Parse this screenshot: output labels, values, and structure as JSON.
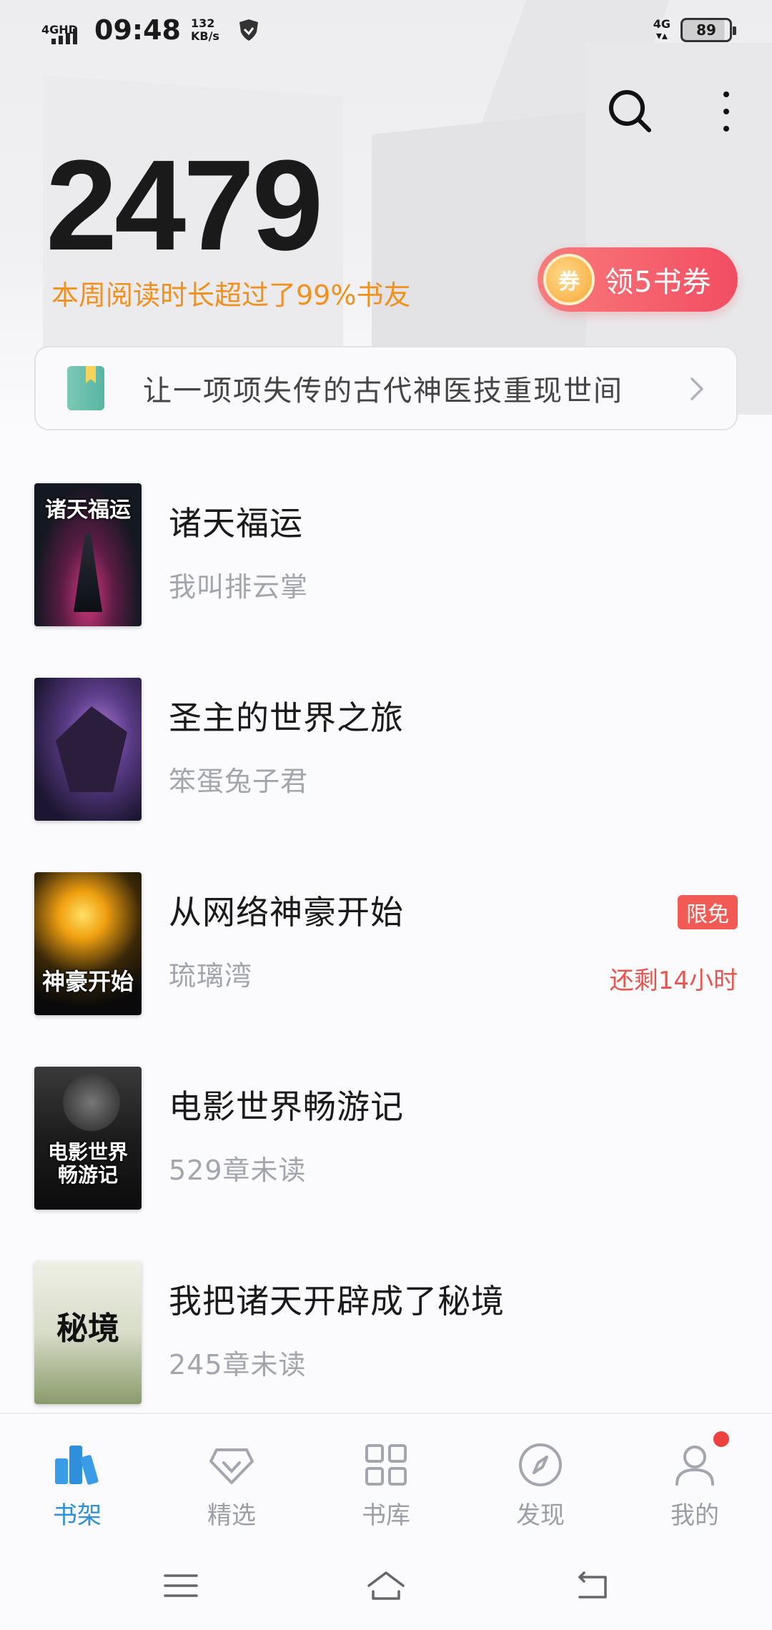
{
  "status_bar": {
    "network": "4GHD",
    "time": "09:48",
    "speed_value": "132",
    "speed_unit": "KB/s",
    "network_right": "4G",
    "battery": "89"
  },
  "header": {
    "search_icon": "search-icon",
    "more_icon": "more-vertical-icon",
    "read_count": "2479",
    "read_subtitle": "本周阅读时长超过了99%书友",
    "coupon_icon_text": "券",
    "coupon_label": "领5书券",
    "colors": {
      "accent_orange": "#f0901e",
      "coupon_red": "#f24d62"
    }
  },
  "recommendation": {
    "text": "让一项项失传的古代神医技重现世间"
  },
  "books": [
    {
      "title": "诸天福运",
      "subtitle": "我叫排云掌",
      "cover_title": "诸天福运"
    },
    {
      "title": "圣主的世界之旅",
      "subtitle": "笨蛋兔子君",
      "cover_title": ""
    },
    {
      "title": "从网络神豪开始",
      "subtitle": "琉璃湾",
      "cover_title": "神豪开始",
      "badge": "限免",
      "remaining": "还剩14小时"
    },
    {
      "title": "电影世界畅游记",
      "subtitle": "529章未读",
      "cover_title": "电影世界畅游记"
    },
    {
      "title": "我把诸天开辟成了秘境",
      "subtitle": "245章未读",
      "cover_title": "秘境"
    }
  ],
  "bottom_nav": [
    {
      "label": "书架",
      "icon": "bookshelf-icon",
      "active": true
    },
    {
      "label": "精选",
      "icon": "diamond-icon"
    },
    {
      "label": "书库",
      "icon": "grid-icon"
    },
    {
      "label": "发现",
      "icon": "compass-icon"
    },
    {
      "label": "我的",
      "icon": "user-icon",
      "badge_dot": true
    }
  ],
  "system_nav": [
    "menu-icon",
    "home-icon",
    "back-icon"
  ]
}
